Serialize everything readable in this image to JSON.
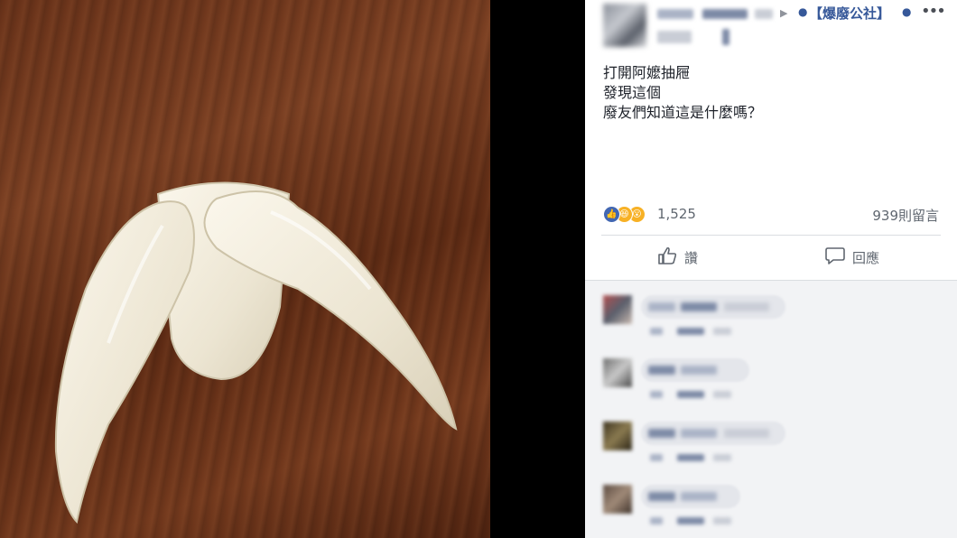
{
  "post": {
    "page_name": "【爆廢公社】",
    "more_icon": "more-dots-icon",
    "arrow_icon": "triangle-right-icon",
    "text_lines": [
      "打開阿嬤抽屜",
      "發現這個",
      "廢友們知道這是什麼嗎？"
    ],
    "reactions": {
      "icons": [
        "like-icon",
        "haha-icon",
        "wow-icon"
      ],
      "count": "1,525"
    },
    "comment_count": "939則留言",
    "actions": {
      "like_label": "讚",
      "comment_label": "回應"
    }
  },
  "photo": {
    "subject": "white-claw-object",
    "background": "wood-table"
  },
  "colors": {
    "link_blue": "#365899",
    "like_blue": "#4267b2",
    "react_yellow": "#f7b125",
    "text": "#1d2129",
    "muted": "#606770"
  }
}
